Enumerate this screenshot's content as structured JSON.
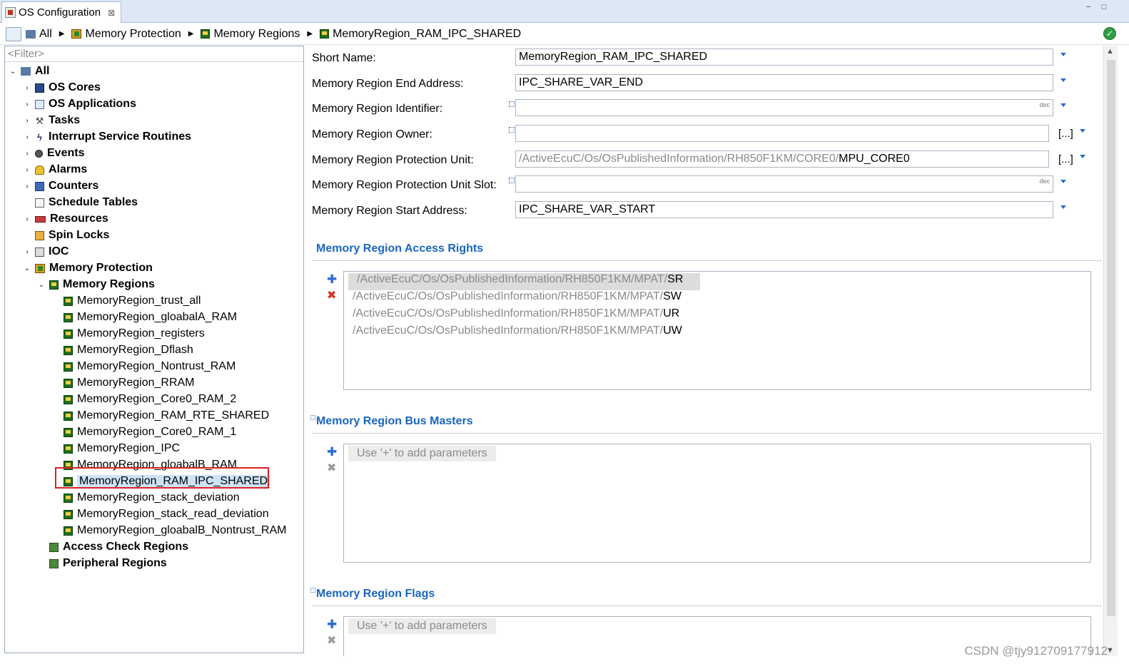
{
  "tab": {
    "title": "OS Configuration",
    "close": "⊠"
  },
  "window": {
    "minimize": "−",
    "maximize": "□"
  },
  "breadcrumb": {
    "items": [
      "All",
      "Memory Protection",
      "Memory Regions",
      "MemoryRegion_RAM_IPC_SHARED"
    ]
  },
  "filter": {
    "placeholder": "<Filter>"
  },
  "tree": {
    "root": "All",
    "items": [
      "OS Cores",
      "OS Applications",
      "Tasks",
      "Interrupt Service Routines",
      "Events",
      "Alarms",
      "Counters",
      "Schedule Tables",
      "Resources",
      "Spin Locks",
      "IOC",
      "Memory Protection",
      "Memory Regions",
      "MemoryRegion_trust_all",
      "MemoryRegion_gloabalA_RAM",
      "MemoryRegion_registers",
      "MemoryRegion_Dflash",
      "MemoryRegion_Nontrust_RAM",
      "MemoryRegion_RRAM",
      "MemoryRegion_Core0_RAM_2",
      "MemoryRegion_RAM_RTE_SHARED",
      "MemoryRegion_Core0_RAM_1",
      "MemoryRegion_IPC",
      "MemoryRegion_gloabalB_RAM",
      "MemoryRegion_RAM_IPC_SHARED",
      "MemoryRegion_stack_deviation",
      "MemoryRegion_stack_read_deviation",
      "MemoryRegion_gloabalB_Nontrust_RAM",
      "Access Check Regions",
      "Peripheral Regions"
    ]
  },
  "fields": {
    "short_name": {
      "label": "Short Name:",
      "value": "MemoryRegion_RAM_IPC_SHARED"
    },
    "end_address": {
      "label": "Memory Region End Address:",
      "value": "IPC_SHARE_VAR_END"
    },
    "identifier": {
      "label": "Memory Region Identifier:",
      "value": "",
      "unit": "dec"
    },
    "owner": {
      "label": "Memory Region Owner:",
      "value": "",
      "browse": "[...]"
    },
    "protection_unit": {
      "label": "Memory Region Protection Unit:",
      "prefix": "/ActiveEcuC/Os/OsPublishedInformation/RH850F1KM/CORE0/",
      "value": "MPU_CORE0",
      "browse": "[...]"
    },
    "protection_unit_slot": {
      "label": "Memory Region Protection Unit Slot:",
      "value": "",
      "unit": "dec"
    },
    "start_address": {
      "label": "Memory Region Start Address:",
      "value": "IPC_SHARE_VAR_START"
    }
  },
  "access_rights": {
    "title": "Memory Region Access Rights",
    "prefix": "/ActiveEcuC/Os/OsPublishedInformation/RH850F1KM/MPAT/",
    "items": [
      "SR",
      "SW",
      "UR",
      "UW"
    ]
  },
  "bus_masters": {
    "title": "Memory Region Bus Masters",
    "placeholder": "Use '+' to add parameters"
  },
  "flags": {
    "title": "Memory Region Flags",
    "placeholder": "Use '+' to add parameters"
  },
  "list_buttons": {
    "add": "✚",
    "remove": "✖"
  },
  "watermark": "CSDN @tjy912709177912",
  "colors": {
    "accent": "#1a66c0",
    "selection": "#cde3f8",
    "highlight": "#e02020"
  }
}
